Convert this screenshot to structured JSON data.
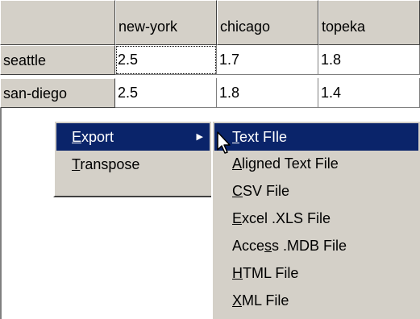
{
  "grid": {
    "columns": [
      "new-york",
      "chicago",
      "topeka"
    ],
    "rows": [
      {
        "label": "seattle",
        "values": [
          "2.5",
          "1.7",
          "1.8"
        ]
      },
      {
        "label": "san-diego",
        "values": [
          "2.5",
          "1.8",
          "1.4"
        ]
      }
    ]
  },
  "context_menu": {
    "items": [
      {
        "mnemonic": "E",
        "rest": "xport",
        "has_submenu": true
      },
      {
        "mnemonic": "T",
        "rest": "ranspose",
        "has_submenu": false
      }
    ]
  },
  "export_submenu": {
    "items": [
      {
        "pre": "",
        "mnemonic": "T",
        "rest": "ext FIle"
      },
      {
        "pre": "",
        "mnemonic": "A",
        "rest": "ligned Text File"
      },
      {
        "pre": "",
        "mnemonic": "C",
        "rest": "SV File"
      },
      {
        "pre": "",
        "mnemonic": "E",
        "rest": "xcel .XLS File"
      },
      {
        "pre": "Acce",
        "mnemonic": "s",
        "rest": "s .MDB File"
      },
      {
        "pre": "",
        "mnemonic": "H",
        "rest": "TML File"
      },
      {
        "pre": "",
        "mnemonic": "X",
        "rest": "ML File"
      }
    ]
  },
  "colors": {
    "menu_bg": "#d4d0c8",
    "highlight": "#0a246a",
    "highlight_text": "#ffffff"
  }
}
